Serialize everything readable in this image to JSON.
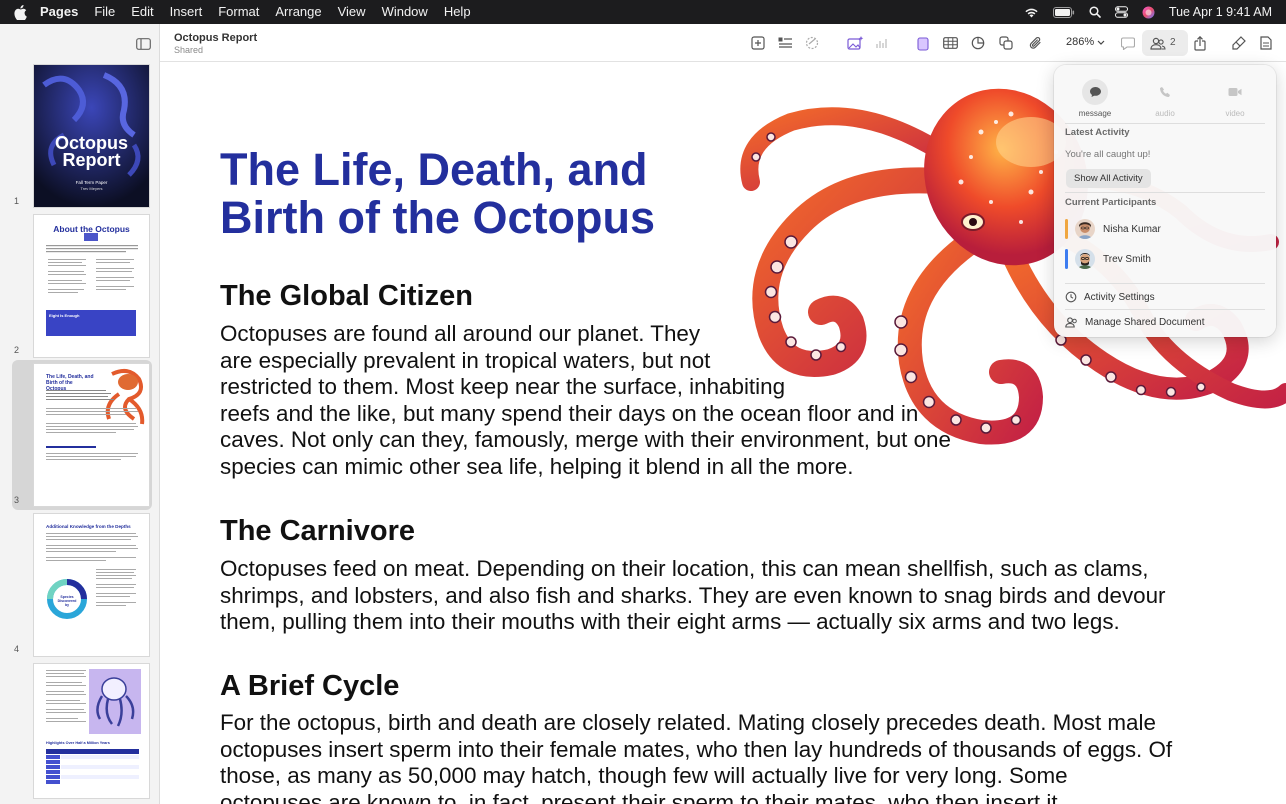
{
  "menubar": {
    "app_name": "Pages",
    "items": [
      "File",
      "Edit",
      "Insert",
      "Format",
      "Arrange",
      "View",
      "Window",
      "Help"
    ],
    "clock": "Tue Apr 1  9:41 AM"
  },
  "toolbar": {
    "doc_title": "Octopus Report",
    "doc_subtitle": "Shared",
    "zoom": "286%",
    "collaborator_count": "2"
  },
  "sidebar": {
    "pages": [
      {
        "number": "1",
        "title_line1": "Octopus",
        "title_line2": "Report",
        "sub1": "Fall Term Paper",
        "sub2": "Trev Meyers"
      },
      {
        "number": "2",
        "title": "About the Octopus",
        "box": "Eight Is Enough"
      },
      {
        "number": "3",
        "title": "The Life, Death, and Birth of the Octopus"
      },
      {
        "number": "4",
        "title": "Additional Knowledge from the Depths",
        "donut": "Species Discovered by"
      },
      {
        "number": "5",
        "table_title": "Highlights Over Half a Million Years"
      }
    ]
  },
  "document": {
    "title_line1": "The Life, Death, and",
    "title_line2": "Birth of the Octopus",
    "sections": [
      {
        "heading": "The Global Citizen",
        "lines": [
          "Octopuses are found all around our planet. They",
          "are especially prevalent in tropical waters, but not",
          "restricted to them. Most keep near the surface, inhabiting",
          "reefs and the like, but many spend their days on the ocean floor and in",
          "caves. Not only can they, famously, merge with their environment, but one",
          "species can mimic other sea life, helping it blend in all the more."
        ]
      },
      {
        "heading": "The Carnivore",
        "lines": [
          "Octopuses feed on meat. Depending on their location, this can mean shellfish, such as clams,",
          "shrimps, and lobsters, and also fish and sharks. They are even known to snag birds and devour",
          "them, pulling them into their mouths with their eight arms — actually six arms and two legs."
        ]
      },
      {
        "heading": "A Brief Cycle",
        "lines": [
          "For the octopus, birth and death are closely related. Mating closely precedes death. Most male",
          "octopuses insert sperm into their female mates, who then lay hundreds of thousands of eggs. Of",
          "those, as many as 50,000 may hatch, though few will actually live for very long. Some",
          "octopuses are known to, in fact, present their sperm to their mates, who then insert it"
        ]
      }
    ]
  },
  "popover": {
    "actions": [
      "message",
      "audio",
      "video"
    ],
    "latest_activity_label": "Latest Activity",
    "caught_up": "You're all caught up!",
    "show_all": "Show All Activity",
    "participants_label": "Current Participants",
    "participants": [
      {
        "name": "Nisha Kumar",
        "color": "#f0a640"
      },
      {
        "name": "Trev Smith",
        "color": "#3d7cf0"
      }
    ],
    "activity_settings": "Activity Settings",
    "manage_shared": "Manage Shared Document"
  },
  "colors": {
    "title_blue": "#232f9d",
    "menubar_bg": "#1c1c1e"
  }
}
